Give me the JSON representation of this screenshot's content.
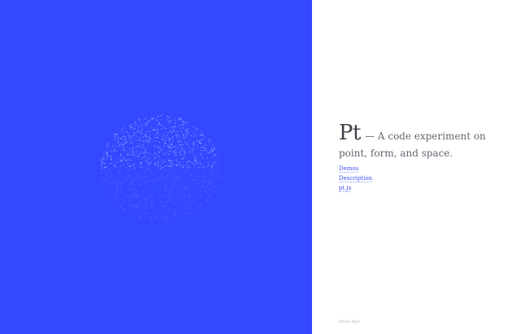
{
  "colors": {
    "accent_blue": "#3448ff",
    "text_dark": "#3f4048",
    "link_blue": "#3d4ef5",
    "background": "#ffffff"
  },
  "hero": {
    "title": "Pt",
    "description": "— A code experiment on point, form, and space."
  },
  "nav": {
    "items": [
      {
        "label": "Demos"
      },
      {
        "label": "Description"
      },
      {
        "label": "pt.js"
      }
    ]
  },
  "footer": {
    "note": "William Ngan"
  }
}
